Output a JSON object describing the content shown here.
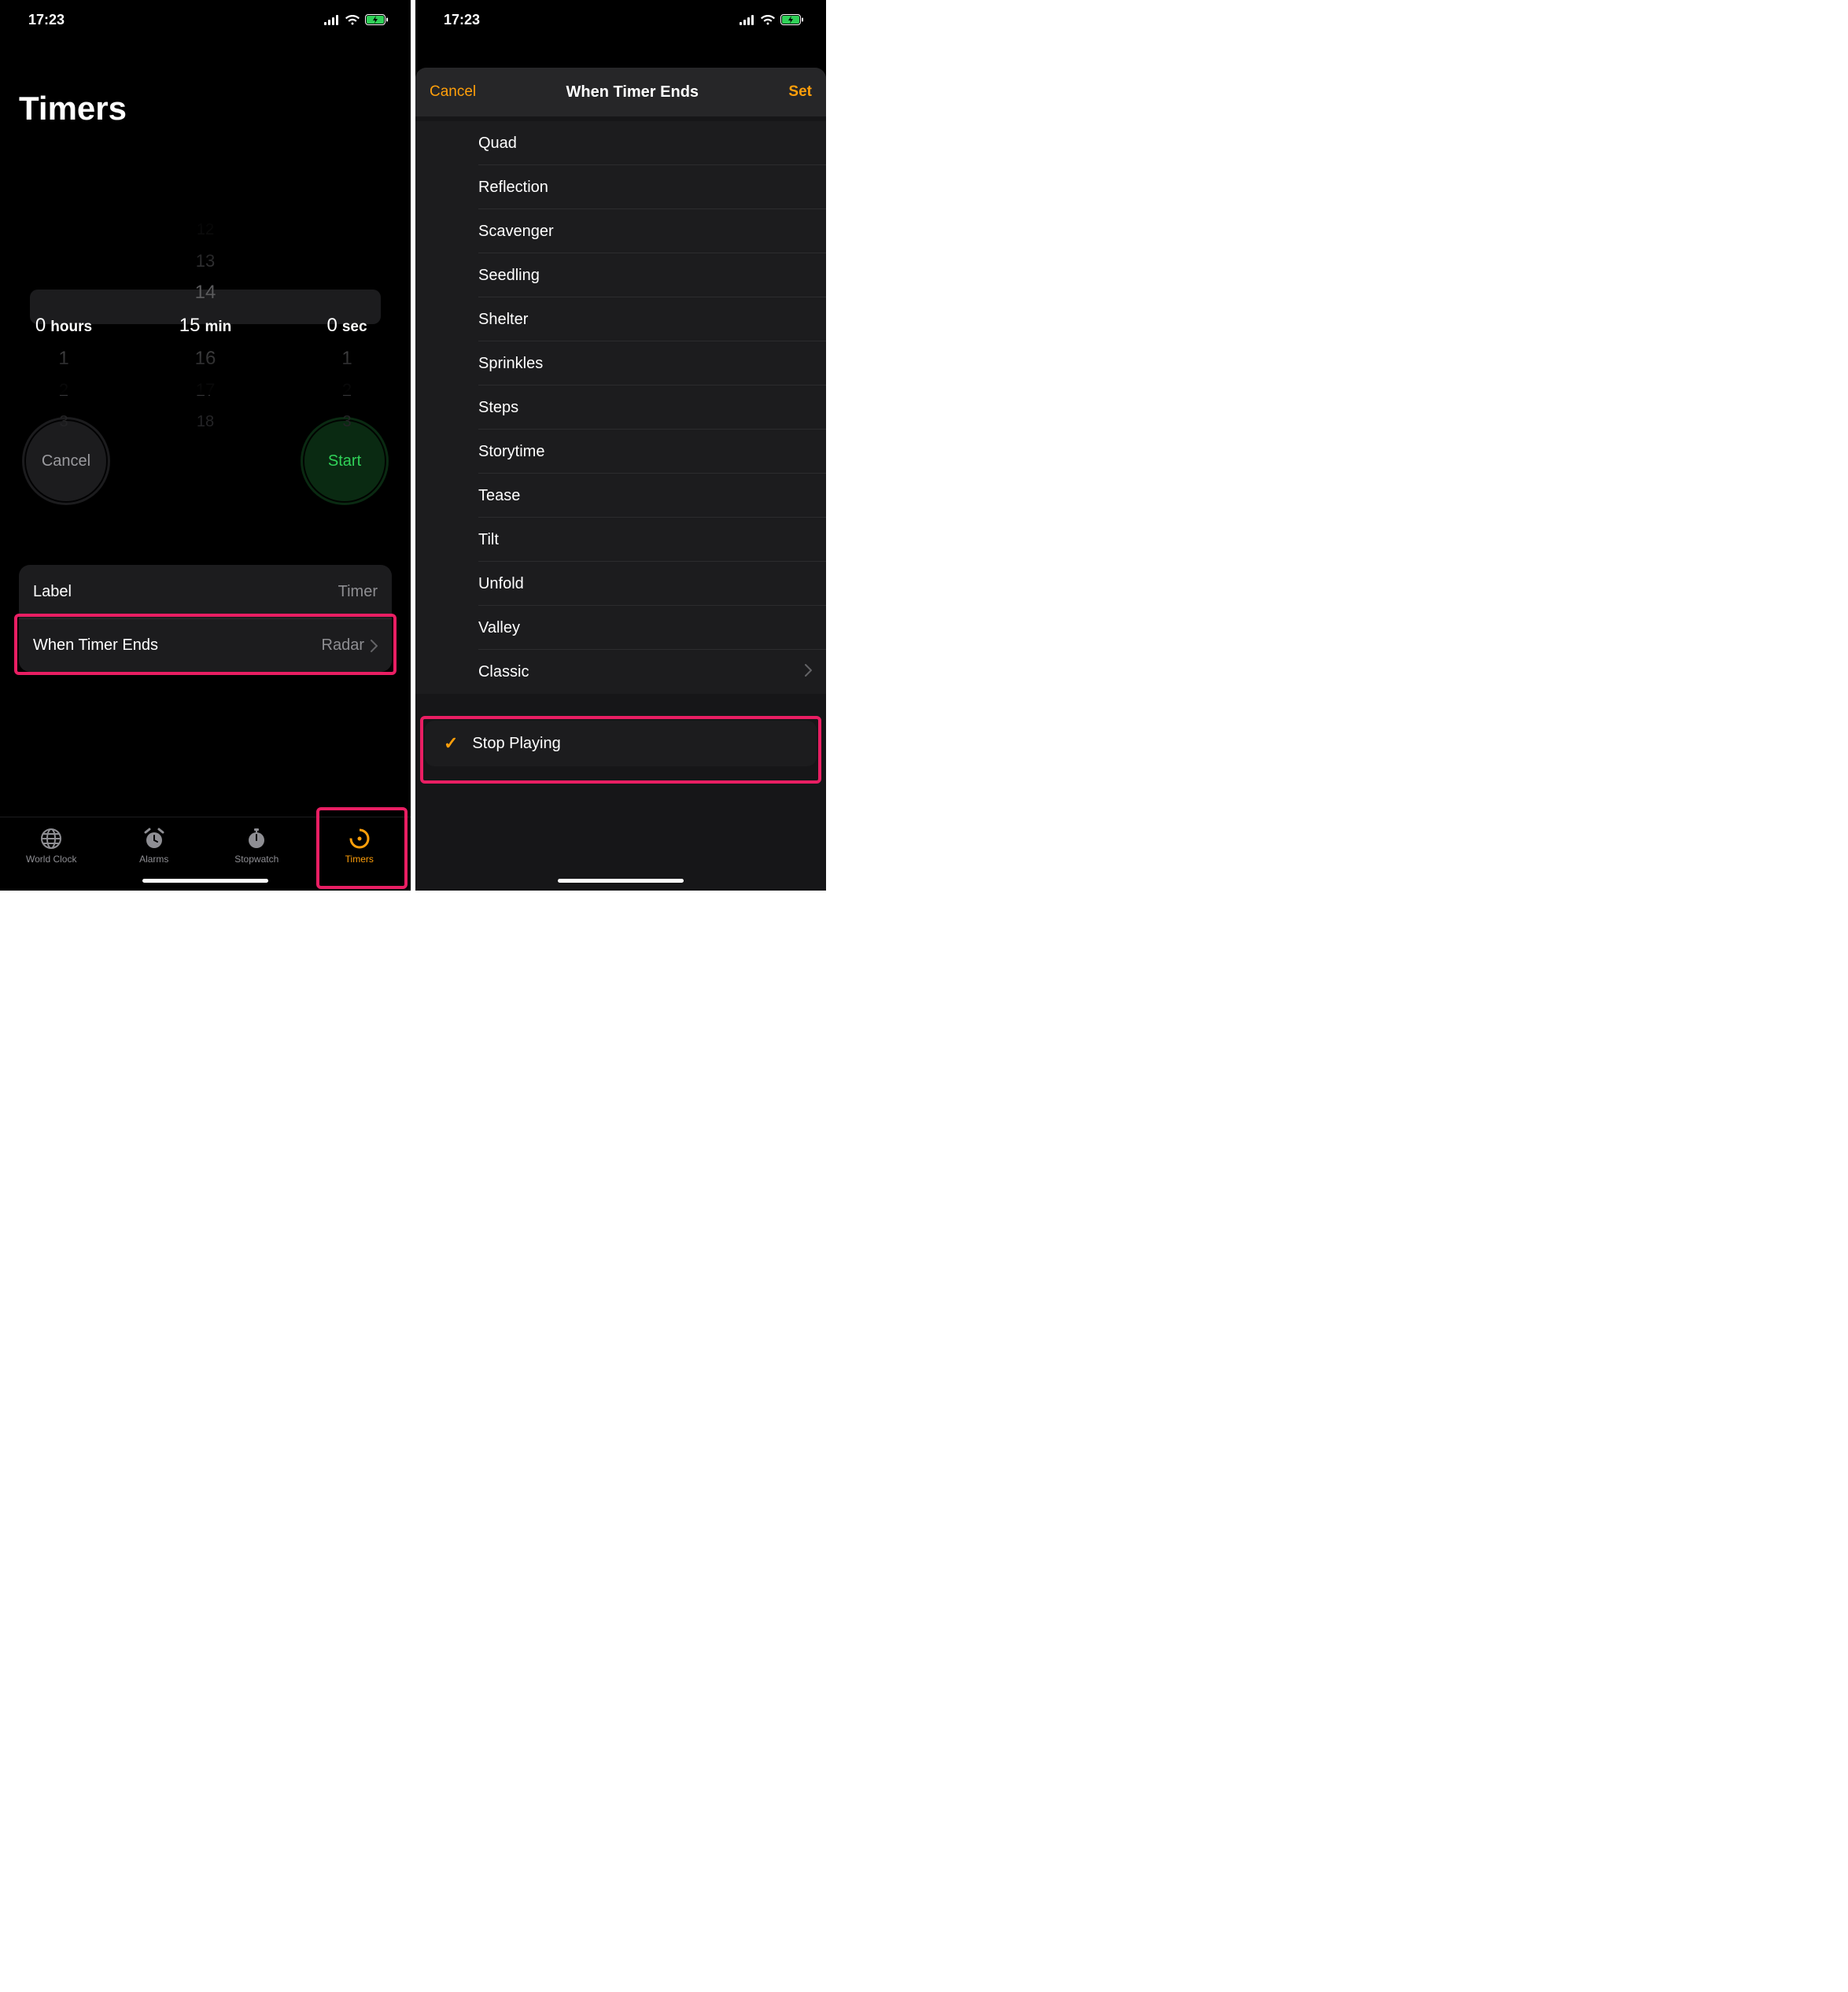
{
  "status": {
    "time": "17:23"
  },
  "left": {
    "title": "Timers",
    "picker": {
      "hours_label": "hours",
      "hours_val": "0",
      "min_label": "min",
      "min_val": "15",
      "sec_label": "sec",
      "sec_val": "0",
      "min_above": [
        "12",
        "13",
        "14"
      ],
      "min_below": [
        "16",
        "17",
        "18"
      ],
      "side_above": [
        "",
        "",
        ""
      ],
      "side_below": [
        "1",
        "2",
        "3"
      ]
    },
    "cancel_label": "Cancel",
    "start_label": "Start",
    "rows": {
      "label_title": "Label",
      "label_value": "Timer",
      "wte_title": "When Timer Ends",
      "wte_value": "Radar"
    },
    "tabs": {
      "world": "World Clock",
      "alarms": "Alarms",
      "stopwatch": "Stopwatch",
      "timers": "Timers"
    }
  },
  "right": {
    "cancel": "Cancel",
    "title": "When Timer Ends",
    "set": "Set",
    "sounds": [
      "Quad",
      "Reflection",
      "Scavenger",
      "Seedling",
      "Shelter",
      "Sprinkles",
      "Steps",
      "Storytime",
      "Tease",
      "Tilt",
      "Unfold",
      "Valley"
    ],
    "classic": "Classic",
    "stop_playing": "Stop Playing"
  }
}
